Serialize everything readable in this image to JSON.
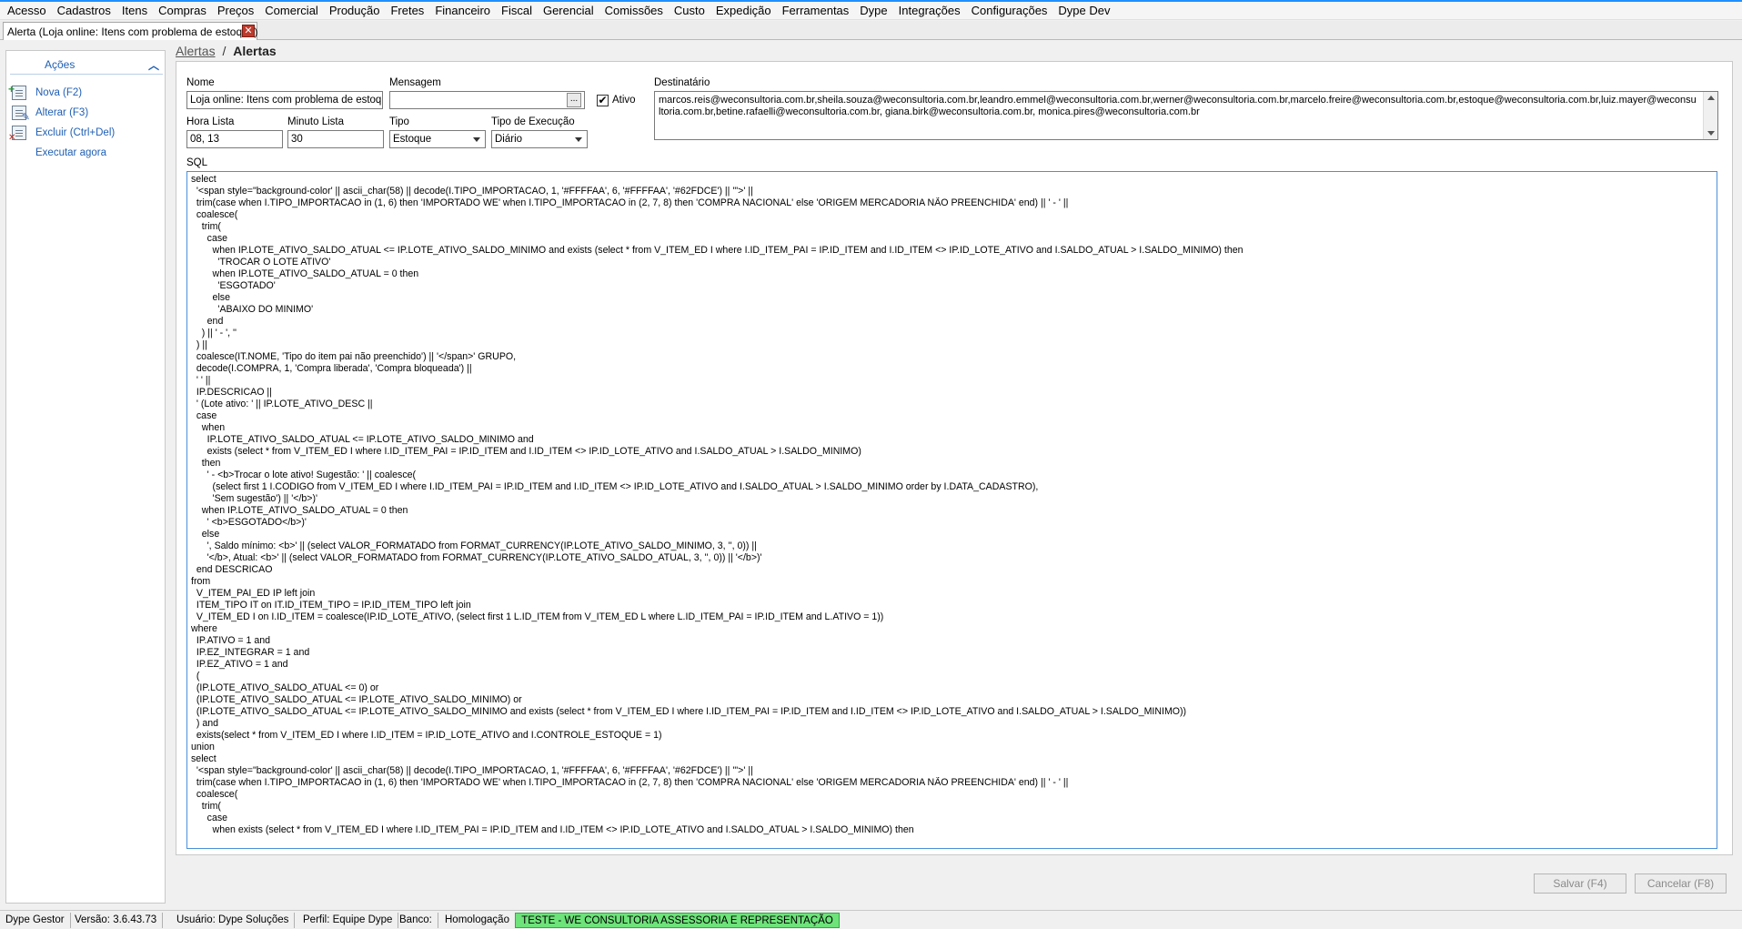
{
  "menu": [
    "Acesso",
    "Cadastros",
    "Itens",
    "Compras",
    "Preços",
    "Comercial",
    "Produção",
    "Fretes",
    "Financeiro",
    "Fiscal",
    "Gerencial",
    "Comissões",
    "Custo",
    "Expedição",
    "Ferramentas",
    "Dype",
    "Integrações",
    "Configurações",
    "Dype Dev"
  ],
  "tab": {
    "title": "Alerta (Loja online: Itens com problema de estoque)",
    "close": "✕"
  },
  "sidebar": {
    "title": "Ações",
    "actions": [
      {
        "label": "Nova (F2)",
        "icon": "new-document-icon"
      },
      {
        "label": "Alterar (F3)",
        "icon": "edit-document-icon"
      },
      {
        "label": "Excluir (Ctrl+Del)",
        "icon": "delete-document-icon"
      },
      {
        "label": "Executar agora",
        "icon": ""
      }
    ]
  },
  "breadcrumb": {
    "parent": "Alertas",
    "separator": "/",
    "current": "Alertas"
  },
  "form": {
    "nome_label": "Nome",
    "nome_value": "Loja online: Itens com problema de estoque",
    "mensagem_label": "Mensagem",
    "mensagem_value": "",
    "mensagem_button": "...",
    "ativo_label": "Ativo",
    "ativo_checked": "✔",
    "destinatario_label": "Destinatário",
    "destinatario_value": "marcos.reis@weconsultoria.com.br,sheila.souza@weconsultoria.com.br,leandro.emmel@weconsultoria.com.br,werner@weconsultoria.com.br,marcelo.freire@weconsultoria.com.br,estoque@weconsultoria.com.br,luiz.mayer@weconsultoria.com.br,betine.rafaelli@weconsultoria.com.br, giana.birk@weconsultoria.com.br, monica.pires@weconsultoria.com.br",
    "hora_label": "Hora Lista",
    "hora_value": "08, 13",
    "minuto_label": "Minuto Lista",
    "minuto_value": "30",
    "tipo_label": "Tipo",
    "tipo_value": "Estoque",
    "execucao_label": "Tipo de Execução",
    "execucao_value": "Diário",
    "sql_label": "SQL",
    "sql_lines": [
      "select",
      "  '<span style=\"background-color' || ascii_char(58) || decode(I.TIPO_IMPORTACAO, 1, '#FFFFAA', 6, '#FFFFAA', '#62FDCE') || '\">' ||",
      "  trim(case when I.TIPO_IMPORTACAO in (1, 6) then 'IMPORTADO WE' when I.TIPO_IMPORTACAO in (2, 7, 8) then 'COMPRA NACIONAL' else 'ORIGEM MERCADORIA NÃO PREENCHIDA' end) || ' - ' ||",
      "  coalesce(",
      "    trim(",
      "      case",
      "        when IP.LOTE_ATIVO_SALDO_ATUAL <= IP.LOTE_ATIVO_SALDO_MINIMO and exists (select * from V_ITEM_ED I where I.ID_ITEM_PAI = IP.ID_ITEM and I.ID_ITEM <> IP.ID_LOTE_ATIVO and I.SALDO_ATUAL > I.SALDO_MINIMO) then",
      "          'TROCAR O LOTE ATIVO'",
      "        when IP.LOTE_ATIVO_SALDO_ATUAL = 0 then",
      "          'ESGOTADO'",
      "        else",
      "          'ABAIXO DO MINIMO'",
      "      end",
      "    ) || ' - ', ''",
      "  ) ||",
      "  coalesce(IT.NOME, 'Tipo do item pai não preenchido') || '</span>' GRUPO,",
      "  decode(I.COMPRA, 1, 'Compra liberada', 'Compra bloqueada') ||",
      "  ' ' ||",
      "  IP.DESCRICAO ||",
      "  ' (Lote ativo: ' || IP.LOTE_ATIVO_DESC ||",
      "  case",
      "    when",
      "      IP.LOTE_ATIVO_SALDO_ATUAL <= IP.LOTE_ATIVO_SALDO_MINIMO and",
      "      exists (select * from V_ITEM_ED I where I.ID_ITEM_PAI = IP.ID_ITEM and I.ID_ITEM <> IP.ID_LOTE_ATIVO and I.SALDO_ATUAL > I.SALDO_MINIMO)",
      "    then",
      "      ' - <b>Trocar o lote ativo! Sugestão: ' || coalesce(",
      "        (select first 1 I.CODIGO from V_ITEM_ED I where I.ID_ITEM_PAI = IP.ID_ITEM and I.ID_ITEM <> IP.ID_LOTE_ATIVO and I.SALDO_ATUAL > I.SALDO_MINIMO order by I.DATA_CADASTRO),",
      "        'Sem sugestão') || '</b>)'",
      "    when IP.LOTE_ATIVO_SALDO_ATUAL = 0 then",
      "      ' <b>ESGOTADO</b>)'",
      "    else",
      "      ', Saldo mínimo: <b>' || (select VALOR_FORMATADO from FORMAT_CURRENCY(IP.LOTE_ATIVO_SALDO_MINIMO, 3, '', 0)) ||",
      "      '</b>, Atual: <b>' || (select VALOR_FORMATADO from FORMAT_CURRENCY(IP.LOTE_ATIVO_SALDO_ATUAL, 3, '', 0)) || '</b>)'",
      "  end DESCRICAO",
      "from",
      "  V_ITEM_PAI_ED IP left join",
      "  ITEM_TIPO IT on IT.ID_ITEM_TIPO = IP.ID_ITEM_TIPO left join",
      "  V_ITEM_ED I on I.ID_ITEM = coalesce(IP.ID_LOTE_ATIVO, (select first 1 L.ID_ITEM from V_ITEM_ED L where L.ID_ITEM_PAI = IP.ID_ITEM and L.ATIVO = 1))",
      "where",
      "  IP.ATIVO = 1 and",
      "  IP.EZ_INTEGRAR = 1 and",
      "  IP.EZ_ATIVO = 1 and",
      "  (",
      "  (IP.LOTE_ATIVO_SALDO_ATUAL <= 0) or",
      "  (IP.LOTE_ATIVO_SALDO_ATUAL <= IP.LOTE_ATIVO_SALDO_MINIMO) or",
      "  (IP.LOTE_ATIVO_SALDO_ATUAL <= IP.LOTE_ATIVO_SALDO_MINIMO and exists (select * from V_ITEM_ED I where I.ID_ITEM_PAI = IP.ID_ITEM and I.ID_ITEM <> IP.ID_LOTE_ATIVO and I.SALDO_ATUAL > I.SALDO_MINIMO))",
      "  ) and",
      "  exists(select * from V_ITEM_ED I where I.ID_ITEM = IP.ID_LOTE_ATIVO and I.CONTROLE_ESTOQUE = 1)",
      "union",
      "select",
      "  '<span style=\"background-color' || ascii_char(58) || decode(I.TIPO_IMPORTACAO, 1, '#FFFFAA', 6, '#FFFFAA', '#62FDCE') || '\">' ||",
      "  trim(case when I.TIPO_IMPORTACAO in (1, 6) then 'IMPORTADO WE' when I.TIPO_IMPORTACAO in (2, 7, 8) then 'COMPRA NACIONAL' else 'ORIGEM MERCADORIA NÃO PREENCHIDA' end) || ' - ' ||",
      "  coalesce(",
      "    trim(",
      "      case",
      "        when exists (select * from V_ITEM_ED I where I.ID_ITEM_PAI = IP.ID_ITEM and I.ID_ITEM <> IP.ID_LOTE_ATIVO and I.SALDO_ATUAL > I.SALDO_MINIMO) then"
    ]
  },
  "buttons": {
    "save": "Salvar (F4)",
    "cancel": "Cancelar (F8)"
  },
  "status": {
    "app": "Dype Gestor",
    "version": "Versão: 3.6.43.73",
    "user": "Usuário: Dype Soluções",
    "profile": "Perfil: Equipe Dype",
    "db_label": "Banco:",
    "db_value": "Homologação",
    "environment": "TESTE - WE CONSULTORIA ASSESSORIA E REPRESENTAÇÃO"
  },
  "colors": {
    "accent": "#1f5fb4",
    "environment_badge": "#6de37a",
    "sql_border": "#4a90d9"
  }
}
